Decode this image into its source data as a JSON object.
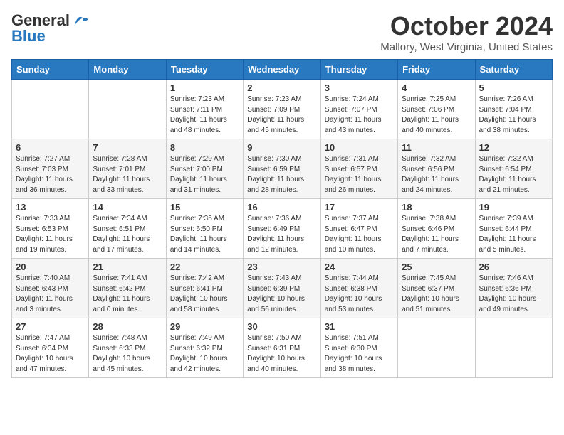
{
  "header": {
    "logo_general": "General",
    "logo_blue": "Blue",
    "month": "October 2024",
    "location": "Mallory, West Virginia, United States"
  },
  "weekdays": [
    "Sunday",
    "Monday",
    "Tuesday",
    "Wednesday",
    "Thursday",
    "Friday",
    "Saturday"
  ],
  "weeks": [
    [
      {
        "day": "",
        "info": ""
      },
      {
        "day": "",
        "info": ""
      },
      {
        "day": "1",
        "info": "Sunrise: 7:23 AM\nSunset: 7:11 PM\nDaylight: 11 hours\nand 48 minutes."
      },
      {
        "day": "2",
        "info": "Sunrise: 7:23 AM\nSunset: 7:09 PM\nDaylight: 11 hours\nand 45 minutes."
      },
      {
        "day": "3",
        "info": "Sunrise: 7:24 AM\nSunset: 7:07 PM\nDaylight: 11 hours\nand 43 minutes."
      },
      {
        "day": "4",
        "info": "Sunrise: 7:25 AM\nSunset: 7:06 PM\nDaylight: 11 hours\nand 40 minutes."
      },
      {
        "day": "5",
        "info": "Sunrise: 7:26 AM\nSunset: 7:04 PM\nDaylight: 11 hours\nand 38 minutes."
      }
    ],
    [
      {
        "day": "6",
        "info": "Sunrise: 7:27 AM\nSunset: 7:03 PM\nDaylight: 11 hours\nand 36 minutes."
      },
      {
        "day": "7",
        "info": "Sunrise: 7:28 AM\nSunset: 7:01 PM\nDaylight: 11 hours\nand 33 minutes."
      },
      {
        "day": "8",
        "info": "Sunrise: 7:29 AM\nSunset: 7:00 PM\nDaylight: 11 hours\nand 31 minutes."
      },
      {
        "day": "9",
        "info": "Sunrise: 7:30 AM\nSunset: 6:59 PM\nDaylight: 11 hours\nand 28 minutes."
      },
      {
        "day": "10",
        "info": "Sunrise: 7:31 AM\nSunset: 6:57 PM\nDaylight: 11 hours\nand 26 minutes."
      },
      {
        "day": "11",
        "info": "Sunrise: 7:32 AM\nSunset: 6:56 PM\nDaylight: 11 hours\nand 24 minutes."
      },
      {
        "day": "12",
        "info": "Sunrise: 7:32 AM\nSunset: 6:54 PM\nDaylight: 11 hours\nand 21 minutes."
      }
    ],
    [
      {
        "day": "13",
        "info": "Sunrise: 7:33 AM\nSunset: 6:53 PM\nDaylight: 11 hours\nand 19 minutes."
      },
      {
        "day": "14",
        "info": "Sunrise: 7:34 AM\nSunset: 6:51 PM\nDaylight: 11 hours\nand 17 minutes."
      },
      {
        "day": "15",
        "info": "Sunrise: 7:35 AM\nSunset: 6:50 PM\nDaylight: 11 hours\nand 14 minutes."
      },
      {
        "day": "16",
        "info": "Sunrise: 7:36 AM\nSunset: 6:49 PM\nDaylight: 11 hours\nand 12 minutes."
      },
      {
        "day": "17",
        "info": "Sunrise: 7:37 AM\nSunset: 6:47 PM\nDaylight: 11 hours\nand 10 minutes."
      },
      {
        "day": "18",
        "info": "Sunrise: 7:38 AM\nSunset: 6:46 PM\nDaylight: 11 hours\nand 7 minutes."
      },
      {
        "day": "19",
        "info": "Sunrise: 7:39 AM\nSunset: 6:44 PM\nDaylight: 11 hours\nand 5 minutes."
      }
    ],
    [
      {
        "day": "20",
        "info": "Sunrise: 7:40 AM\nSunset: 6:43 PM\nDaylight: 11 hours\nand 3 minutes."
      },
      {
        "day": "21",
        "info": "Sunrise: 7:41 AM\nSunset: 6:42 PM\nDaylight: 11 hours\nand 0 minutes."
      },
      {
        "day": "22",
        "info": "Sunrise: 7:42 AM\nSunset: 6:41 PM\nDaylight: 10 hours\nand 58 minutes."
      },
      {
        "day": "23",
        "info": "Sunrise: 7:43 AM\nSunset: 6:39 PM\nDaylight: 10 hours\nand 56 minutes."
      },
      {
        "day": "24",
        "info": "Sunrise: 7:44 AM\nSunset: 6:38 PM\nDaylight: 10 hours\nand 53 minutes."
      },
      {
        "day": "25",
        "info": "Sunrise: 7:45 AM\nSunset: 6:37 PM\nDaylight: 10 hours\nand 51 minutes."
      },
      {
        "day": "26",
        "info": "Sunrise: 7:46 AM\nSunset: 6:36 PM\nDaylight: 10 hours\nand 49 minutes."
      }
    ],
    [
      {
        "day": "27",
        "info": "Sunrise: 7:47 AM\nSunset: 6:34 PM\nDaylight: 10 hours\nand 47 minutes."
      },
      {
        "day": "28",
        "info": "Sunrise: 7:48 AM\nSunset: 6:33 PM\nDaylight: 10 hours\nand 45 minutes."
      },
      {
        "day": "29",
        "info": "Sunrise: 7:49 AM\nSunset: 6:32 PM\nDaylight: 10 hours\nand 42 minutes."
      },
      {
        "day": "30",
        "info": "Sunrise: 7:50 AM\nSunset: 6:31 PM\nDaylight: 10 hours\nand 40 minutes."
      },
      {
        "day": "31",
        "info": "Sunrise: 7:51 AM\nSunset: 6:30 PM\nDaylight: 10 hours\nand 38 minutes."
      },
      {
        "day": "",
        "info": ""
      },
      {
        "day": "",
        "info": ""
      }
    ]
  ]
}
